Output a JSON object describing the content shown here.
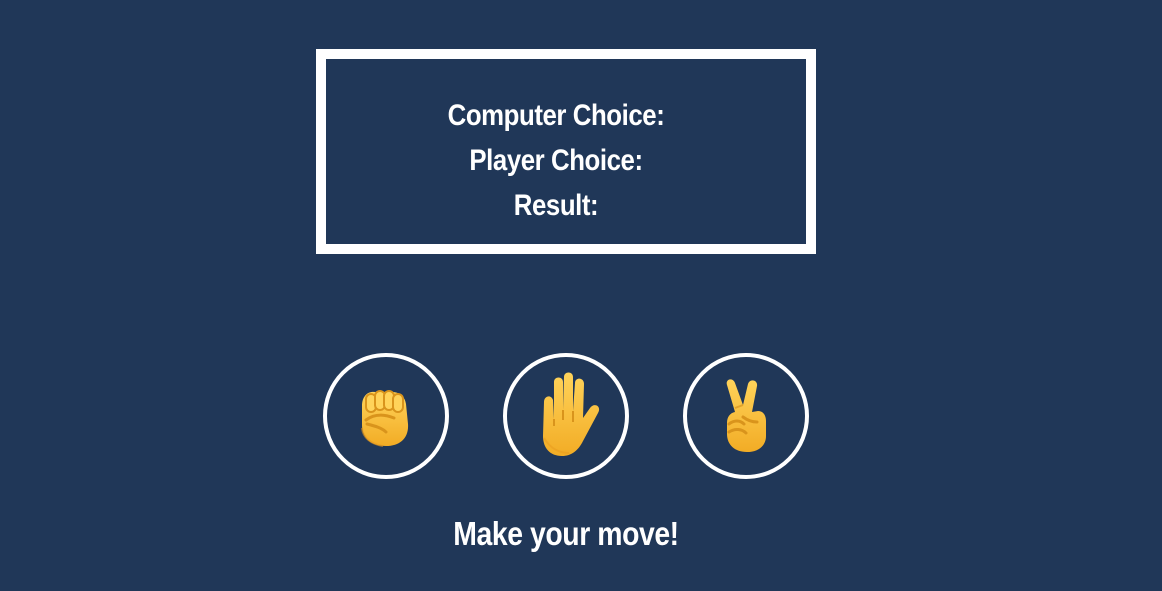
{
  "scoreboard": {
    "computer_choice_label": "Computer Choice:",
    "player_choice_label": "Player Choice:",
    "result_label": "Result:"
  },
  "choices": [
    {
      "name": "rock",
      "icon": "raised-fist-icon"
    },
    {
      "name": "paper",
      "icon": "raised-hand-icon"
    },
    {
      "name": "scissors",
      "icon": "victory-hand-icon"
    }
  ],
  "prompt": "Make your move!",
  "colors": {
    "background": "#203758",
    "border": "#ffffff",
    "text": "#ffffff",
    "emoji_skin": "#f8c13a"
  }
}
